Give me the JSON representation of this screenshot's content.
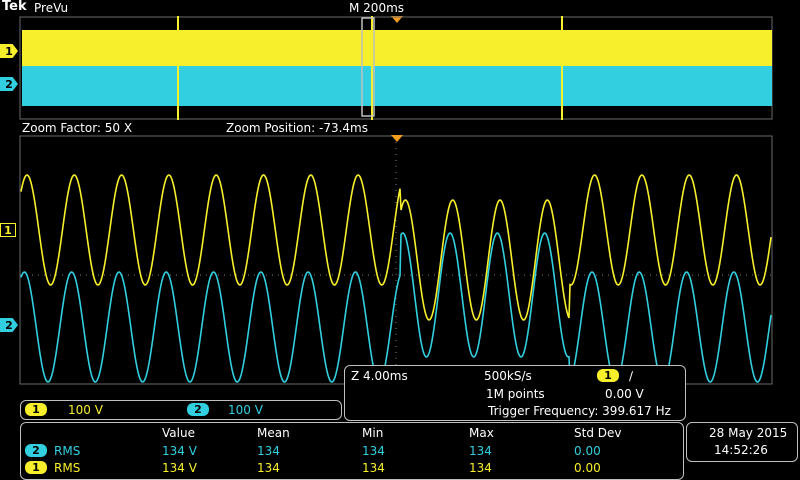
{
  "header": {
    "brand": "Tek",
    "mode": "PreVu",
    "timebase": "M 200ms"
  },
  "zoom": {
    "factor": "Zoom Factor: 50 X",
    "position": "Zoom Position: -73.4ms"
  },
  "channels": [
    {
      "id": "1",
      "scale": "100 V",
      "color": "#f7ef2b"
    },
    {
      "id": "2",
      "scale": "100 V",
      "color": "#31cfe0"
    }
  ],
  "acquisition": {
    "zoom_time": "Z 4.00ms",
    "sample_rate": "500kS/s",
    "record_length": "1M points",
    "trigger_channel": "1",
    "trigger_level": "0.00 V",
    "trigger_slope_symbol": "∕",
    "trigger_frequency": "Trigger Frequency: 399.617 Hz"
  },
  "measurements": {
    "headers": [
      "Value",
      "Mean",
      "Min",
      "Max",
      "Std Dev"
    ],
    "rows": [
      {
        "channel": "2",
        "name": "RMS",
        "value": "134 V",
        "mean": "134",
        "min": "134",
        "max": "134",
        "std": "0.00"
      },
      {
        "channel": "1",
        "name": "RMS",
        "value": "134 V",
        "mean": "134",
        "min": "134",
        "max": "134",
        "std": "0.00"
      }
    ]
  },
  "datetime": {
    "date": "28 May  2015",
    "time": "14:52:26"
  },
  "colors": {
    "ch1": "#f7ef2b",
    "ch2": "#31cfe0",
    "trigger": "#f39c1e",
    "grid": "#6a6a6a"
  }
}
